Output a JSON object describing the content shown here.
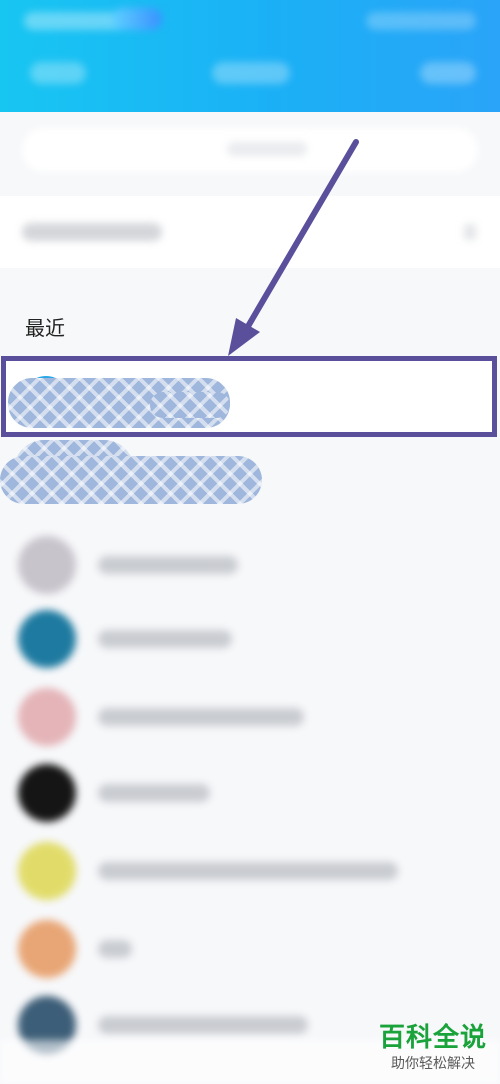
{
  "colors": {
    "header_start": "#18c6f2",
    "header_end": "#2aa4f8",
    "annotation": "#5a4f9b",
    "scribble": "#9fb7dc",
    "watermark_green": "#1aa33a"
  },
  "recent": {
    "section_label": "最近",
    "contacts": [
      {
        "avatar_color": "#c8c4cc"
      },
      {
        "avatar_color": "#1e7aa0"
      },
      {
        "avatar_color": "#e4b4b8"
      },
      {
        "avatar_color": "#151515"
      },
      {
        "avatar_color": "#e1dc6a"
      },
      {
        "avatar_color": "#e8a676"
      },
      {
        "avatar_color": "#3d5e78"
      }
    ]
  },
  "watermark": {
    "title": "百科全说",
    "subtitle": "助你轻松解决"
  }
}
